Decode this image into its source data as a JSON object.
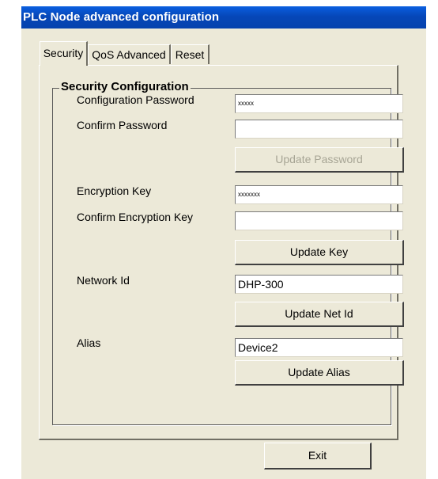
{
  "window": {
    "title": "PLC Node advanced configuration"
  },
  "tabs": [
    {
      "label": "Security",
      "active": true
    },
    {
      "label": "QoS Advanced",
      "active": false
    },
    {
      "label": "Reset",
      "active": false
    }
  ],
  "security": {
    "group_title": "Security Configuration",
    "config_password_label": "Configuration Password",
    "config_password_value": "xxxxx",
    "confirm_password_label": "Confirm Password",
    "confirm_password_value": "",
    "update_password_label": "Update Password",
    "update_password_enabled": false,
    "encryption_key_label": "Encryption Key",
    "encryption_key_value": "xxxxxxx",
    "confirm_encryption_key_label": "Confirm Encryption Key",
    "confirm_encryption_key_value": "",
    "update_key_label": "Update Key",
    "network_id_label": "Network Id",
    "network_id_value": "DHP-300",
    "update_net_id_label": "Update Net Id",
    "alias_label": "Alias",
    "alias_value": "Device2",
    "update_alias_label": "Update Alias"
  },
  "footer": {
    "exit_label": "Exit"
  },
  "colors": {
    "title_bar": "#0a5fe0",
    "dialog_bg": "#ece9d8",
    "disabled_text": "#a7a595"
  }
}
